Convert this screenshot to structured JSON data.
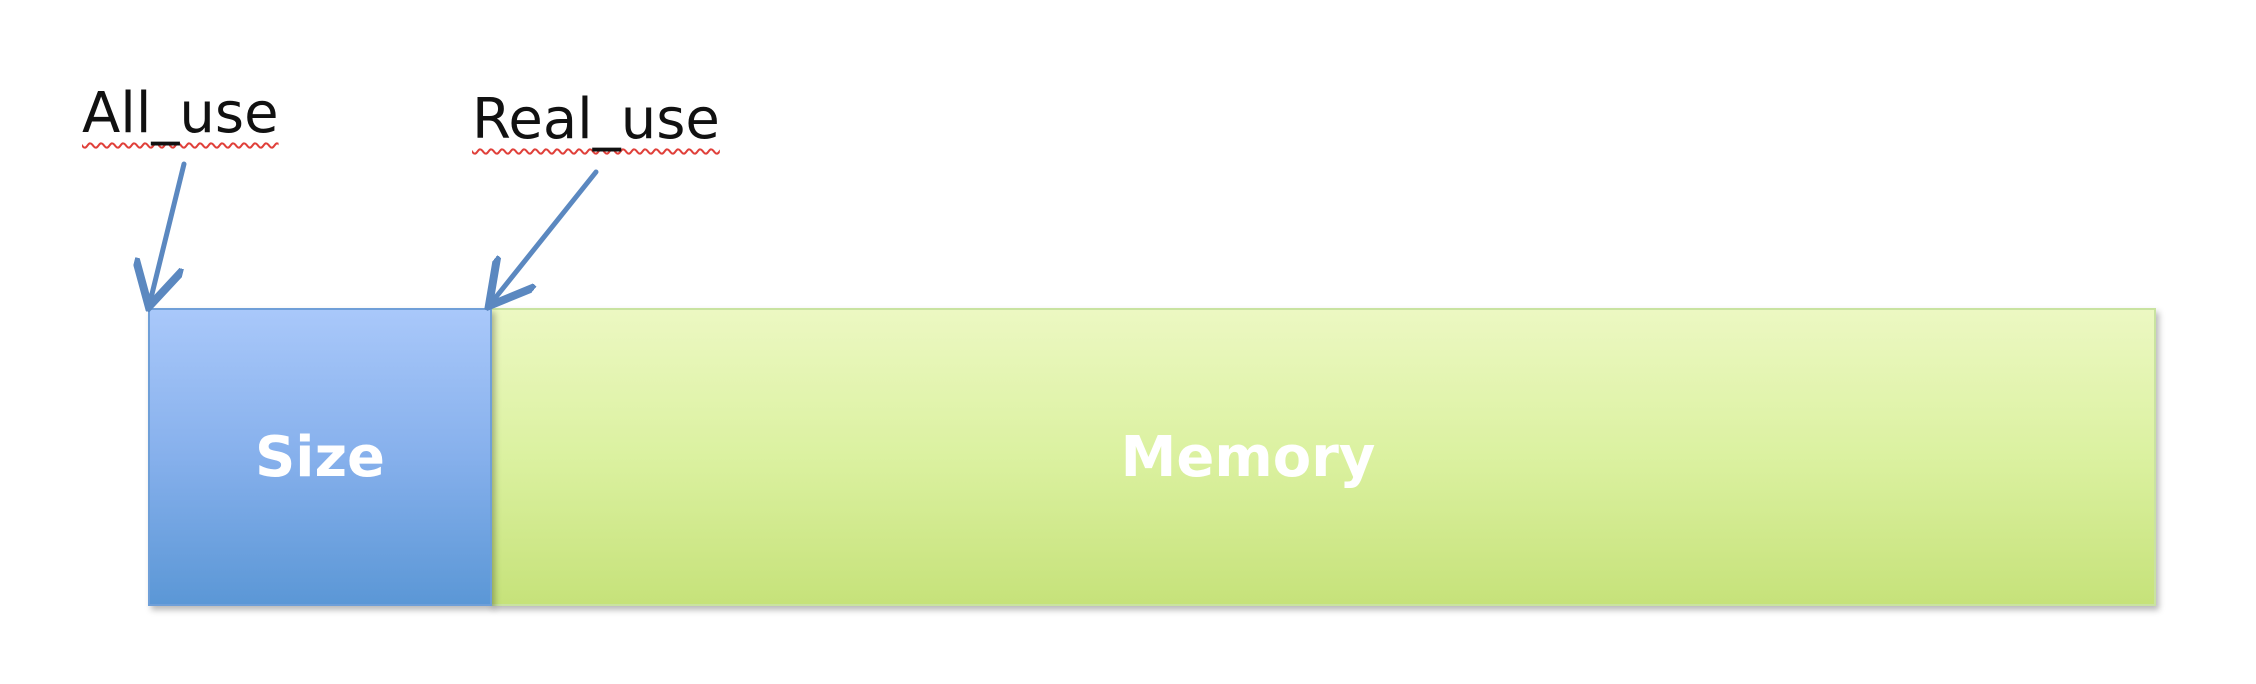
{
  "labels": {
    "all_use": "All_use",
    "real_use": "Real_use"
  },
  "blocks": {
    "size": "Size",
    "memory": "Memory"
  },
  "colors": {
    "size_block": "#86b0ec",
    "memory_block": "#dbf1a0",
    "arrow": "#5b88c0",
    "spellcheck_underline": "#e0403a"
  }
}
